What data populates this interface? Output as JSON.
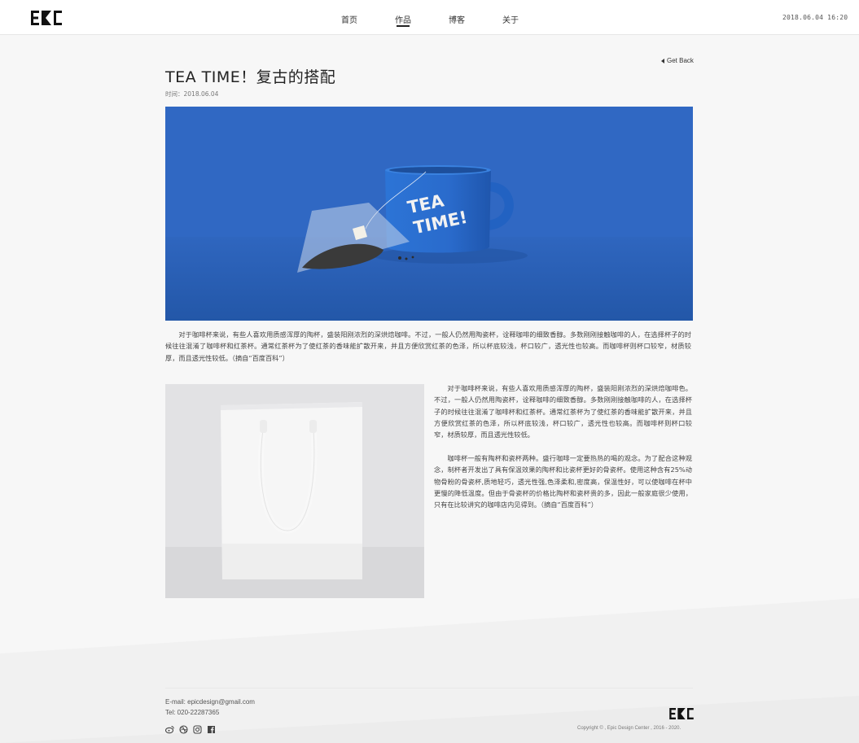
{
  "header": {
    "logo_text": "EPC",
    "nav": [
      {
        "label": "首页",
        "active": false
      },
      {
        "label": "作品",
        "active": true
      },
      {
        "label": "博客",
        "active": false
      },
      {
        "label": "关于",
        "active": false
      }
    ],
    "datetime": "2018.06.04  16:20"
  },
  "article": {
    "back_label": "Get Back",
    "title": "TEA TIME！复古的搭配",
    "meta_label": "时间：",
    "meta_date": "2018.06.04",
    "hero_mug_text": [
      "TEA",
      "TIME!"
    ],
    "para1": "对于咖啡杯来说，有些人喜欢用质感浑厚的陶杯，盛装阳刚浓烈的深烘焙咖啡。不过，一般人仍然用陶瓷杯，诠释咖啡的细致香醇。多数刚刚接触咖啡的人，在选择杯子的时候往往混淆了咖啡杯和红茶杯。通常红茶杯为了使红茶的香味能扩散开来，并且方便欣赏红茶的色泽，所以杯底较浅，杯口较广，透光性也较高。而咖啡杯则杯口较窄，材质较厚，而且透光性较低。（摘自“百度百科”）",
    "para2": "对于咖啡杯来说，有些人喜欢用质感浑厚的陶杯，盛装阳刚浓烈的深烘焙咖啡色。不过，一般人仍然用陶瓷杯，诠释咖啡的细致香醇。多数刚刚接触咖啡的人，在选择杯子的时候往往混淆了咖啡杯和红茶杯。通常红茶杯为了使红茶的香味能扩散开来，并且方便欣赏红茶的色泽，所以杯底较浅，杯口较广，透光性也较高。而咖啡杯则杯口较窄，材质较厚，而且透光性较低。",
    "para3": "咖啡杯一般有陶杯和瓷杯两种。盛行咖啡一定要热热的喝的观念。为了配合这种观念，制杯者开发出了具有保温效果的陶杯和比瓷杯更好的骨瓷杯。使用这种含有25%动物骨粉的骨瓷杯,质地轻巧，透光性强,色泽柔和,密度高，保温性好，可以使咖啡在杯中更慢的降低温度。但由于骨瓷杯的价格比陶杯和瓷杯贵的多，因此一般家庭很少使用，只有在比较讲究的咖啡店内见得到。（摘自“百度百科”）"
  },
  "footer": {
    "email": "E-mail: epicdesign@gmail.com",
    "tel": "Tel: 020-22287365",
    "social_icons": [
      "weibo-icon",
      "dribbble-icon",
      "instagram-icon",
      "facebook-icon"
    ],
    "logo_text": "EPC",
    "copyright": "Copyright © , Epic Design Center , 2016 - 2020."
  },
  "colors": {
    "hero_blue": "#2f67c2",
    "mug_blue": "#2a6fd0",
    "page_bg": "#f7f7f7"
  }
}
